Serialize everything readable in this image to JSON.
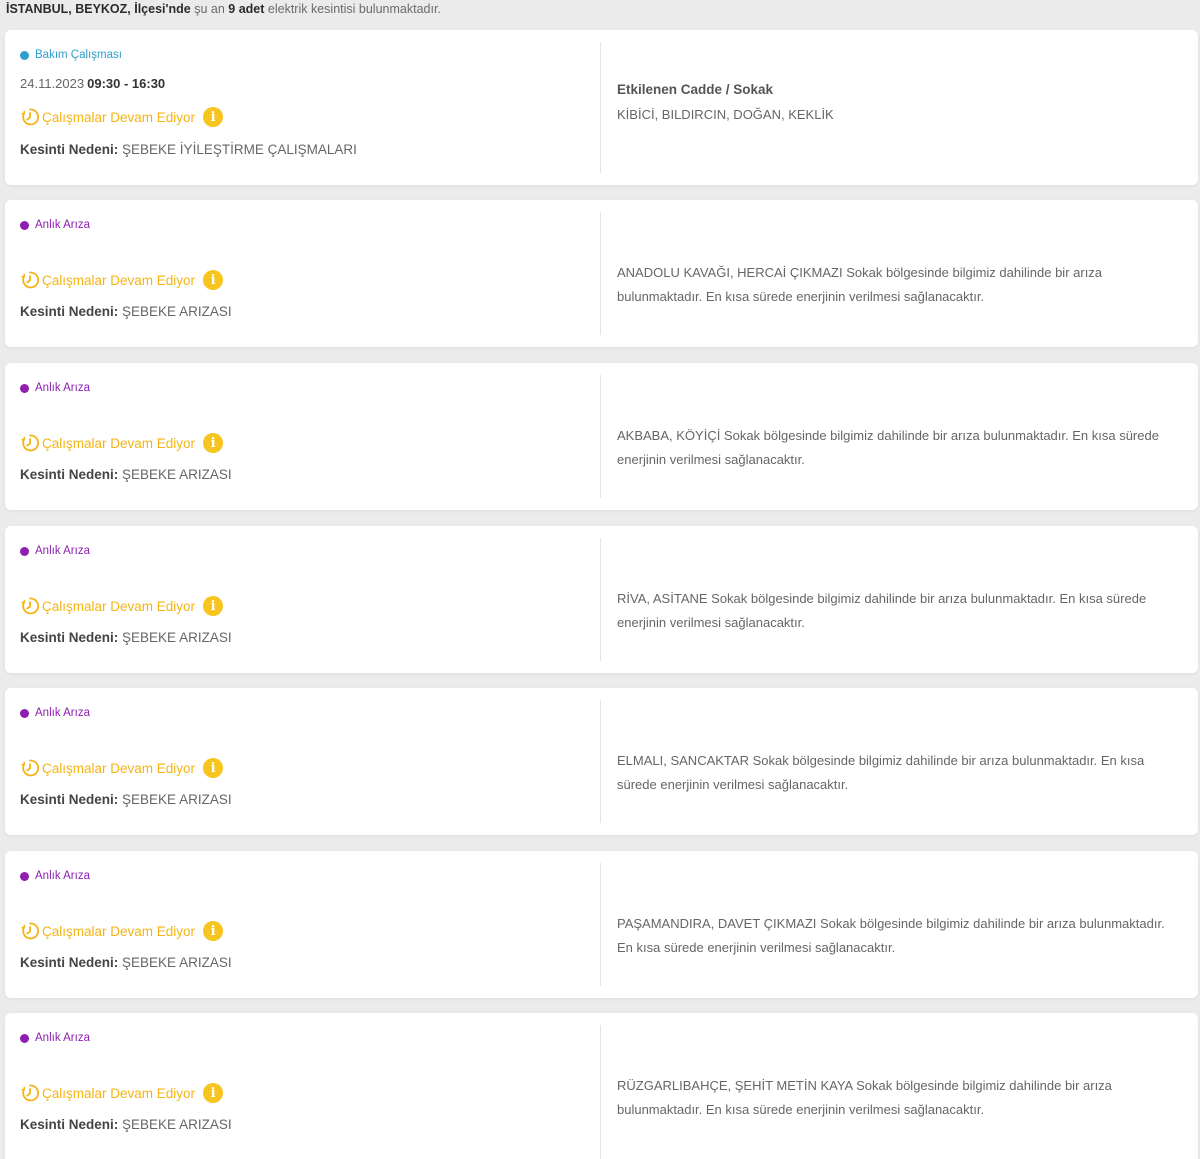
{
  "header": {
    "location": "İSTANBUL, BEYKOZ, İlçesi'nde",
    "pre": "şu an",
    "count": "9 adet",
    "post": "elektrik kesintisi bulunmaktadır."
  },
  "colors": {
    "maintenance": "#2e9fc9",
    "instant_fault": "#8e1fb0",
    "status": "#f5b413",
    "info": "#f7c520"
  },
  "cards": [
    {
      "type": "Bakım Çalışması",
      "date": "24.11.2023",
      "hours": "09:30 - 16:30",
      "status": "Çalışmalar Devam Ediyor",
      "reason_label": "Kesinti Nedeni:",
      "reason": "ŞEBEKE İYİLEŞTİRME ÇALIŞMALARI",
      "right_title": "Etkilenen Cadde / Sokak",
      "right_text": "KİBİCİ, BILDIRCIN, DOĞAN, KEKLİK"
    },
    {
      "type": "Anlık Arıza",
      "status": "Çalışmalar Devam Ediyor",
      "reason_label": "Kesinti Nedeni:",
      "reason": "ŞEBEKE ARIZASI",
      "right_text": "ANADOLU KAVAĞI, HERCAİ ÇIKMAZI Sokak bölgesinde bilgimiz dahilinde bir arıza bulunmaktadır. En kısa sürede enerjinin verilmesi sağlanacaktır."
    },
    {
      "type": "Anlık Arıza",
      "status": "Çalışmalar Devam Ediyor",
      "reason_label": "Kesinti Nedeni:",
      "reason": "ŞEBEKE ARIZASI",
      "right_text": "AKBABA, KÖYİÇİ Sokak bölgesinde bilgimiz dahilinde bir arıza bulunmaktadır. En kısa sürede enerjinin verilmesi sağlanacaktır."
    },
    {
      "type": "Anlık Arıza",
      "status": "Çalışmalar Devam Ediyor",
      "reason_label": "Kesinti Nedeni:",
      "reason": "ŞEBEKE ARIZASI",
      "right_text": "RİVA, ASİTANE Sokak bölgesinde bilgimiz dahilinde bir arıza bulunmaktadır. En kısa sürede enerjinin verilmesi sağlanacaktır."
    },
    {
      "type": "Anlık Arıza",
      "status": "Çalışmalar Devam Ediyor",
      "reason_label": "Kesinti Nedeni:",
      "reason": "ŞEBEKE ARIZASI",
      "right_text": "ELMALI, SANCAKTAR Sokak bölgesinde bilgimiz dahilinde bir arıza bulunmaktadır. En kısa sürede enerjinin verilmesi sağlanacaktır."
    },
    {
      "type": "Anlık Arıza",
      "status": "Çalışmalar Devam Ediyor",
      "reason_label": "Kesinti Nedeni:",
      "reason": "ŞEBEKE ARIZASI",
      "right_text": "PAŞAMANDIRA, DAVET ÇIKMAZI Sokak bölgesinde bilgimiz dahilinde bir arıza bulunmaktadır. En kısa sürede enerjinin verilmesi sağlanacaktır."
    },
    {
      "type": "Anlık Arıza",
      "status": "Çalışmalar Devam Ediyor",
      "reason_label": "Kesinti Nedeni:",
      "reason": "ŞEBEKE ARIZASI",
      "right_text": "RÜZGARLIBAHÇE, ŞEHİT METİN KAYA Sokak bölgesinde bilgimiz dahilinde bir arıza bulunmaktadır. En kısa sürede enerjinin verilmesi sağlanacaktır."
    }
  ]
}
